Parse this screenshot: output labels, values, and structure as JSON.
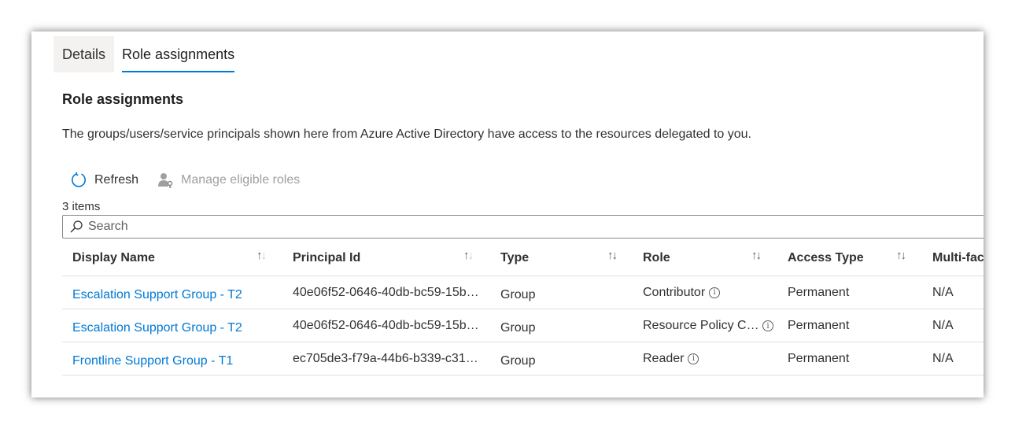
{
  "tabs": [
    {
      "label": "Details",
      "active": false
    },
    {
      "label": "Role assignments",
      "active": true
    }
  ],
  "section": {
    "title": "Role assignments",
    "description": "The groups/users/service principals shown here from Azure Active Directory have access to the resources delegated to you."
  },
  "toolbar": {
    "refresh_label": "Refresh",
    "manage_label": "Manage eligible roles"
  },
  "items_count": "3 items",
  "search": {
    "placeholder": "Search",
    "value": ""
  },
  "columns": {
    "display_name": "Display Name",
    "principal_id": "Principal Id",
    "type": "Type",
    "role": "Role",
    "access_type": "Access Type",
    "multi_factor": "Multi-fac"
  },
  "rows": [
    {
      "display_name": "Escalation Support Group - T2",
      "principal_id": "40e06f52-0646-40db-bc59-15b…",
      "type": "Group",
      "role": "Contributor",
      "access_type": "Permanent",
      "mfa": "N/A"
    },
    {
      "display_name": "Escalation Support Group - T2",
      "principal_id": "40e06f52-0646-40db-bc59-15b…",
      "type": "Group",
      "role": "Resource Policy C…",
      "access_type": "Permanent",
      "mfa": "N/A"
    },
    {
      "display_name": "Frontline Support Group - T1",
      "principal_id": "ec705de3-f79a-44b6-b339-c31…",
      "type": "Group",
      "role": "Reader",
      "access_type": "Permanent",
      "mfa": "N/A"
    }
  ],
  "colors": {
    "accent": "#0078d4",
    "link": "#0078d4",
    "disabled": "#a19f9d"
  },
  "icons": {
    "refresh": "refresh-icon",
    "manage": "person-key-icon",
    "search": "search-icon",
    "info": "info-icon",
    "sort": "sort-arrows-icon"
  }
}
